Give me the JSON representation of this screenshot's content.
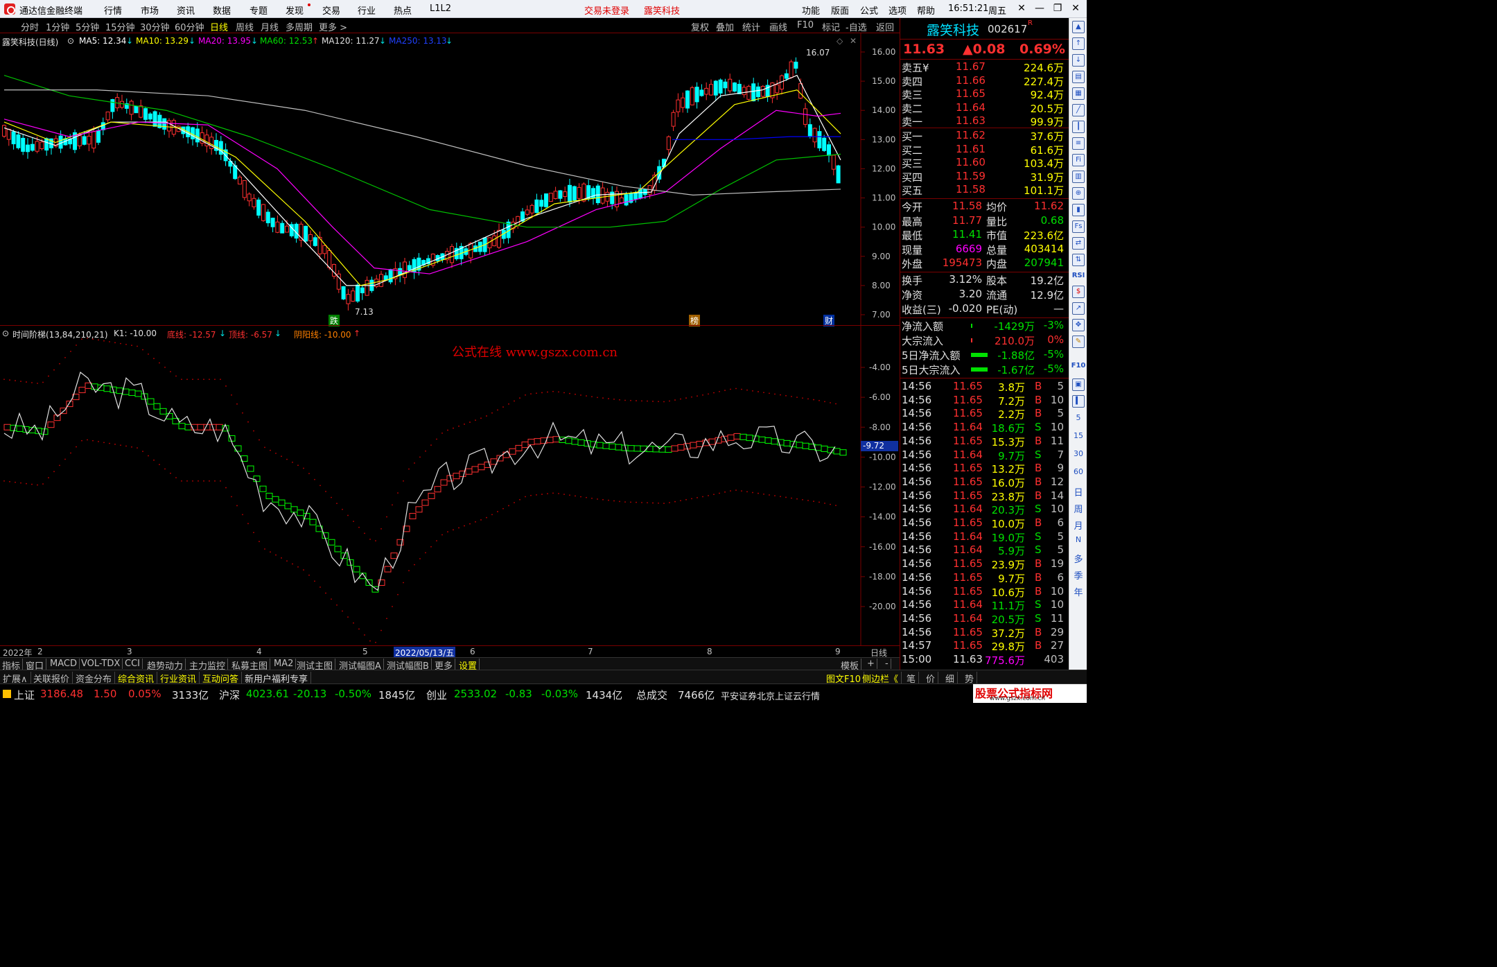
{
  "titlebar": {
    "app": "通达信金融终端",
    "menus": [
      "行情",
      "市场",
      "资讯",
      "数据",
      "专题",
      "发现",
      "交易",
      "行业",
      "热点",
      "L1L2"
    ],
    "status": "交易未登录",
    "stock": "露笑科技",
    "right_menus": [
      "功能",
      "版面",
      "公式",
      "选项",
      "帮助"
    ],
    "time": "16:51:21",
    "weekday": "周五"
  },
  "toolbar": {
    "periods": [
      "分时",
      "1分钟",
      "5分钟",
      "15分钟",
      "30分钟",
      "60分钟",
      "日线",
      "周线",
      "月线",
      "多周期",
      "更多 >"
    ],
    "active": "日线",
    "tools": [
      "复权",
      "叠加",
      "统计",
      "画线",
      "F10",
      "标记",
      "-自选",
      "返回"
    ]
  },
  "main_chart": {
    "legend": {
      "name": "露笑科技(日线)",
      "ma5": "MA5: 12.34",
      "ma10": "MA10: 13.29",
      "ma20": "MA20: 13.95",
      "ma60": "MA60: 12.53",
      "ma120": "MA120: 11.27",
      "ma250": "MA250: 13.13"
    },
    "yticks": [
      "16.00",
      "15.00",
      "14.00",
      "13.00",
      "12.00",
      "11.00",
      "10.00",
      "9.00",
      "8.00",
      "7.00"
    ],
    "high_label": "16.07",
    "low_label": "7.13",
    "markers": [
      "跌",
      "榜",
      "财"
    ]
  },
  "ind_chart": {
    "legend": {
      "name": "时间阶梯(13,84,210,21)",
      "k1": "K1: -10.00",
      "bottom": "底线: -12.57",
      "top": "顶线: -6.57",
      "yinyang": "阴阳线: -10.00"
    },
    "watermark": "公式在线 www.gszx.com.cn",
    "yticks": [
      "-4.00",
      "-6.00",
      "-8.00",
      "-10.00",
      "-12.00",
      "-14.00",
      "-16.00",
      "-18.00",
      "-20.00"
    ],
    "current": "-9.72"
  },
  "xaxis": {
    "labels": [
      "2022年",
      "2",
      "3",
      "4",
      "5",
      "2022/05/13/五",
      "6",
      "7",
      "8",
      "9"
    ],
    "period": "日线"
  },
  "bottombar1": {
    "items": [
      "指标",
      "窗口",
      "MACD",
      "VOL-TDX",
      "CCI",
      "趋势动力",
      "主力监控",
      "私募主图",
      "MA2",
      "测试主图",
      "测试幅图A",
      "测试幅图B",
      "更多",
      "设置"
    ],
    "active": "设置",
    "right": [
      "模板",
      "+",
      "-"
    ]
  },
  "bottombar2": {
    "items": [
      "扩展∧",
      "关联报价",
      "资金分布",
      "综合资讯",
      "行业资讯",
      "互动问答",
      "新用户福利专享"
    ],
    "highlight": [
      "综合资讯",
      "行业资讯",
      "互动问答"
    ],
    "right": [
      "图文F10",
      "侧边栏《",
      "笔",
      "价",
      "细",
      "势"
    ]
  },
  "statusbar": {
    "sh": {
      "name": "上证",
      "price": "3186.48",
      "chg": "1.50",
      "pct": "0.05%",
      "amt": "3133亿"
    },
    "hs": {
      "name": "沪深",
      "price": "4023.61",
      "chg": "-20.13",
      "pct": "-0.50%",
      "amt": "1845亿"
    },
    "cy": {
      "name": "创业",
      "price": "2533.02",
      "chg": "-0.83",
      "pct": "-0.03%",
      "amt": "1434亿"
    },
    "total": {
      "name": "总成交",
      "amt": "7466亿"
    },
    "broker": "平安证券北京上证云行情",
    "site": "股票公式指标网",
    "site_url": "www.gszx.com.cn"
  },
  "quote": {
    "name": "露笑科技",
    "code": "002617",
    "flag": "R",
    "price": "11.63",
    "change": "▲0.08",
    "pct": "0.69%",
    "asks": [
      [
        "卖五¥",
        "11.67",
        "224.6万"
      ],
      [
        "卖四",
        "11.66",
        "227.4万"
      ],
      [
        "卖三",
        "11.65",
        "92.4万"
      ],
      [
        "卖二",
        "11.64",
        "20.5万"
      ],
      [
        "卖一",
        "11.63",
        "99.9万"
      ]
    ],
    "bids": [
      [
        "买一",
        "11.62",
        "37.6万"
      ],
      [
        "买二",
        "11.61",
        "61.6万"
      ],
      [
        "买三",
        "11.60",
        "103.4万"
      ],
      [
        "买四",
        "11.59",
        "31.9万"
      ],
      [
        "买五",
        "11.58",
        "101.1万"
      ]
    ],
    "stats": [
      [
        "今开",
        "11.58",
        "均价",
        "11.62"
      ],
      [
        "最高",
        "11.77",
        "量比",
        "0.68"
      ],
      [
        "最低",
        "11.41",
        "市值",
        "223.6亿"
      ],
      [
        "现量",
        "6669",
        "总量",
        "403414"
      ],
      [
        "外盘",
        "195473",
        "内盘",
        "207941"
      ]
    ],
    "fin": [
      [
        "换手",
        "3.12%",
        "股本",
        "19.2亿"
      ],
      [
        "净资",
        "3.20",
        "流通",
        "12.9亿"
      ],
      [
        "收益(三)",
        "-0.020",
        "PE(动)",
        "—"
      ]
    ],
    "flow": [
      [
        "净流入额",
        "-1429万",
        "-3%"
      ],
      [
        "大宗流入",
        "210.0万",
        "0%"
      ],
      [
        "5日净流入额",
        "-1.88亿",
        "-5%"
      ],
      [
        "5日大宗流入",
        "-1.67亿",
        "-5%"
      ]
    ],
    "ticks": [
      [
        "14:56",
        "11.65",
        "3.8万",
        "B",
        "5"
      ],
      [
        "14:56",
        "11.65",
        "7.2万",
        "B",
        "10"
      ],
      [
        "14:56",
        "11.65",
        "2.2万",
        "B",
        "5"
      ],
      [
        "14:56",
        "11.64",
        "18.6万",
        "S",
        "10"
      ],
      [
        "14:56",
        "11.65",
        "15.3万",
        "B",
        "11"
      ],
      [
        "14:56",
        "11.64",
        "9.7万",
        "S",
        "7"
      ],
      [
        "14:56",
        "11.65",
        "13.2万",
        "B",
        "9"
      ],
      [
        "14:56",
        "11.65",
        "16.0万",
        "B",
        "12"
      ],
      [
        "14:56",
        "11.65",
        "23.8万",
        "B",
        "14"
      ],
      [
        "14:56",
        "11.64",
        "20.3万",
        "S",
        "10"
      ],
      [
        "14:56",
        "11.65",
        "10.0万",
        "B",
        "6"
      ],
      [
        "14:56",
        "11.64",
        "19.0万",
        "S",
        "5"
      ],
      [
        "14:56",
        "11.64",
        "5.9万",
        "S",
        "5"
      ],
      [
        "14:56",
        "11.65",
        "23.9万",
        "B",
        "19"
      ],
      [
        "14:56",
        "11.65",
        "9.7万",
        "B",
        "6"
      ],
      [
        "14:56",
        "11.65",
        "10.6万",
        "B",
        "10"
      ],
      [
        "14:56",
        "11.64",
        "11.1万",
        "S",
        "10"
      ],
      [
        "14:56",
        "11.64",
        "20.5万",
        "S",
        "11"
      ],
      [
        "14:56",
        "11.65",
        "37.2万",
        "B",
        "29"
      ],
      [
        "14:57",
        "11.65",
        "29.8万",
        "B",
        "27"
      ],
      [
        "15:00",
        "11.63",
        "775.6万",
        "",
        "403"
      ]
    ]
  },
  "vtoolbar": {
    "labels": [
      "RSI",
      "F10",
      "日",
      "周",
      "月",
      "N",
      "多",
      "季",
      "年"
    ]
  },
  "colors": {
    "up": "#ff3030",
    "down": "#00e000",
    "grid": "#7a0000",
    "ma5": "#ffffff",
    "ma10": "#ffff00",
    "ma20": "#ff00ff",
    "ma60": "#00c000",
    "ma120": "#c0c0c0",
    "ma250": "#0000ff"
  }
}
